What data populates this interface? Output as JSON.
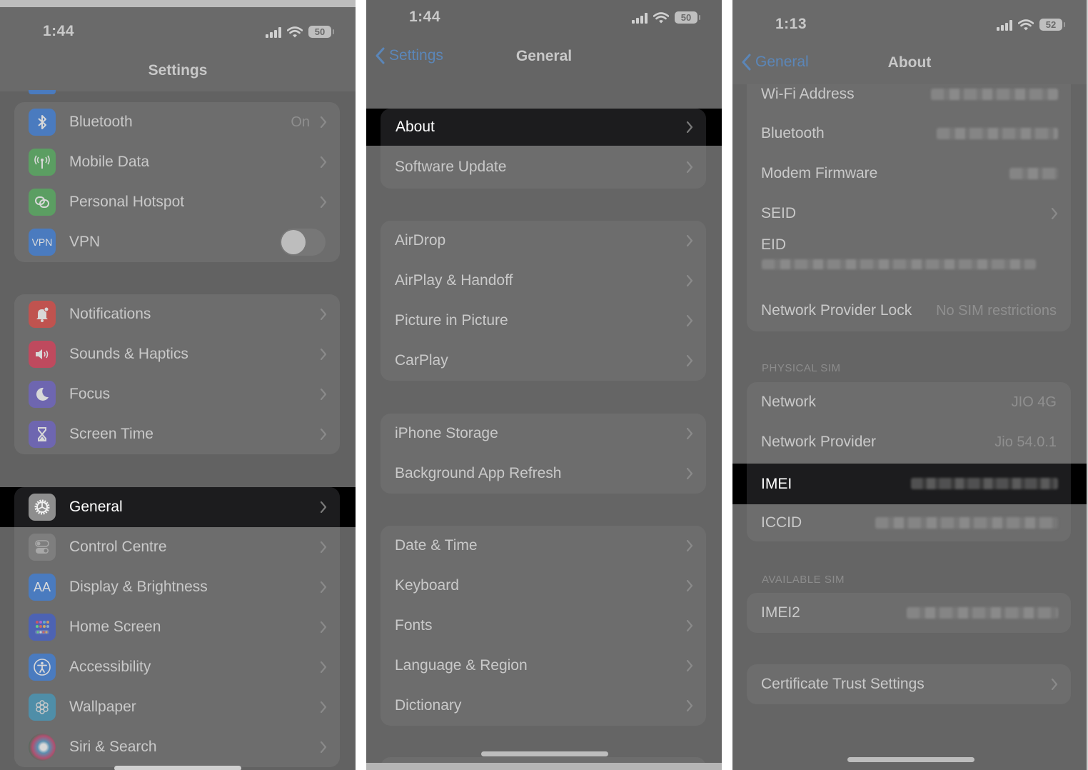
{
  "panels": {
    "settings": {
      "status": {
        "time": "1:44",
        "battery": "50"
      },
      "title": "Settings",
      "connectivity": [
        {
          "label": "Bluetooth",
          "value": "On",
          "icon": "bluetooth-icon",
          "color": "#4a7bbf"
        },
        {
          "label": "Mobile Data",
          "icon": "antenna-icon",
          "color": "#5b9e62"
        },
        {
          "label": "Personal Hotspot",
          "icon": "hotspot-icon",
          "color": "#5b9e62"
        },
        {
          "label": "VPN",
          "icon": "vpn-icon",
          "icon_text": "VPN",
          "color": "#4a7bbf",
          "toggle": "off"
        }
      ],
      "alerts": [
        {
          "label": "Notifications",
          "icon": "bell-icon",
          "color": "#c0534f"
        },
        {
          "label": "Sounds & Haptics",
          "icon": "speaker-icon",
          "color": "#bf4a5e"
        },
        {
          "label": "Focus",
          "icon": "moon-icon",
          "color": "#6e66b0"
        },
        {
          "label": "Screen Time",
          "icon": "hourglass-icon",
          "color": "#6e66b0"
        }
      ],
      "highlighted": {
        "label": "General",
        "icon": "gear-icon",
        "color": "#8e8e8e"
      },
      "system": [
        {
          "label": "Control Centre",
          "icon": "switches-icon",
          "color": "#7e7e7e"
        },
        {
          "label": "Display & Brightness",
          "icon": "text-size-icon",
          "icon_text": "AA",
          "color": "#4a7bbf"
        },
        {
          "label": "Home Screen",
          "icon": "app-grid-icon",
          "color": "#4d63b3"
        },
        {
          "label": "Accessibility",
          "icon": "accessibility-icon",
          "color": "#4a7bbf"
        },
        {
          "label": "Wallpaper",
          "icon": "flower-icon",
          "color": "#4f8ea8"
        },
        {
          "label": "Siri & Search",
          "icon": "siri-icon",
          "color": "#6a6a6a"
        }
      ]
    },
    "general": {
      "status": {
        "time": "1:44",
        "battery": "50"
      },
      "back_label": "Settings",
      "title": "General",
      "highlighted": "About",
      "group1": [
        "Software Update"
      ],
      "group2": [
        "AirDrop",
        "AirPlay & Handoff",
        "Picture in Picture",
        "CarPlay"
      ],
      "group3": [
        "iPhone Storage",
        "Background App Refresh"
      ],
      "group4": [
        "Date & Time",
        "Keyboard",
        "Fonts",
        "Language & Region",
        "Dictionary"
      ]
    },
    "about": {
      "status": {
        "time": "1:13",
        "battery": "52"
      },
      "back_label": "General",
      "title": "About",
      "info_rows": [
        {
          "label": "Wi-Fi Address",
          "value": "[redacted]"
        },
        {
          "label": "Bluetooth",
          "value": "[redacted]"
        },
        {
          "label": "Modem Firmware",
          "value": "[redacted]"
        }
      ],
      "seid_label": "SEID",
      "eid_label": "EID",
      "eid_value": "[redacted]",
      "lock": {
        "label": "Network Provider Lock",
        "value": "No SIM restrictions"
      },
      "physical_sim_header": "PHYSICAL SIM",
      "physical_sim": [
        {
          "label": "Network",
          "value": "JIO 4G"
        },
        {
          "label": "Network Provider",
          "value": "Jio 54.0.1"
        }
      ],
      "imei": {
        "label": "IMEI",
        "value": "[redacted]"
      },
      "iccid": {
        "label": "ICCID",
        "value": "[redacted]"
      },
      "available_sim_header": "AVAILABLE SIM",
      "imei2": {
        "label": "IMEI2",
        "value": "[redacted]"
      },
      "certificate": "Certificate Trust Settings"
    }
  }
}
